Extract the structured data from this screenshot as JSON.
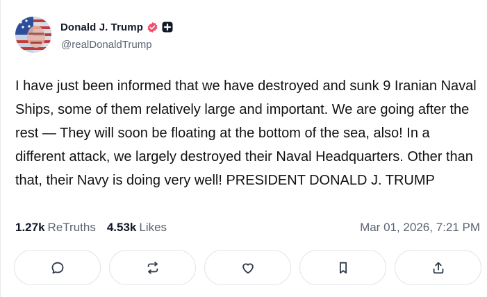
{
  "author": {
    "display_name": "Donald J. Trump",
    "handle": "@realDonaldTrump"
  },
  "post": {
    "text": "I have just been informed that we have destroyed and sunk 9 Iranian Naval Ships, some of them relatively large and important. We are going after the rest — They will soon be floating at the bottom of the sea, also! In a different attack, we largely destroyed their Naval Headquarters. Other than that, their Navy is doing very well! PRESIDENT DONALD J. TRUMP",
    "timestamp": "Mar 01, 2026, 7:21 PM"
  },
  "stats": {
    "retruths_count": "1.27k",
    "retruths_label": "ReTruths",
    "likes_count": "4.53k",
    "likes_label": "Likes"
  },
  "actions": [
    {
      "icon": "comment-icon"
    },
    {
      "icon": "retruth-icon"
    },
    {
      "icon": "heart-icon"
    },
    {
      "icon": "bookmark-icon"
    },
    {
      "icon": "share-icon"
    }
  ],
  "colors": {
    "verified_badge": "#f0506e",
    "text_primary": "#111827",
    "text_secondary": "#5b6472",
    "border": "#dfe3e8"
  }
}
